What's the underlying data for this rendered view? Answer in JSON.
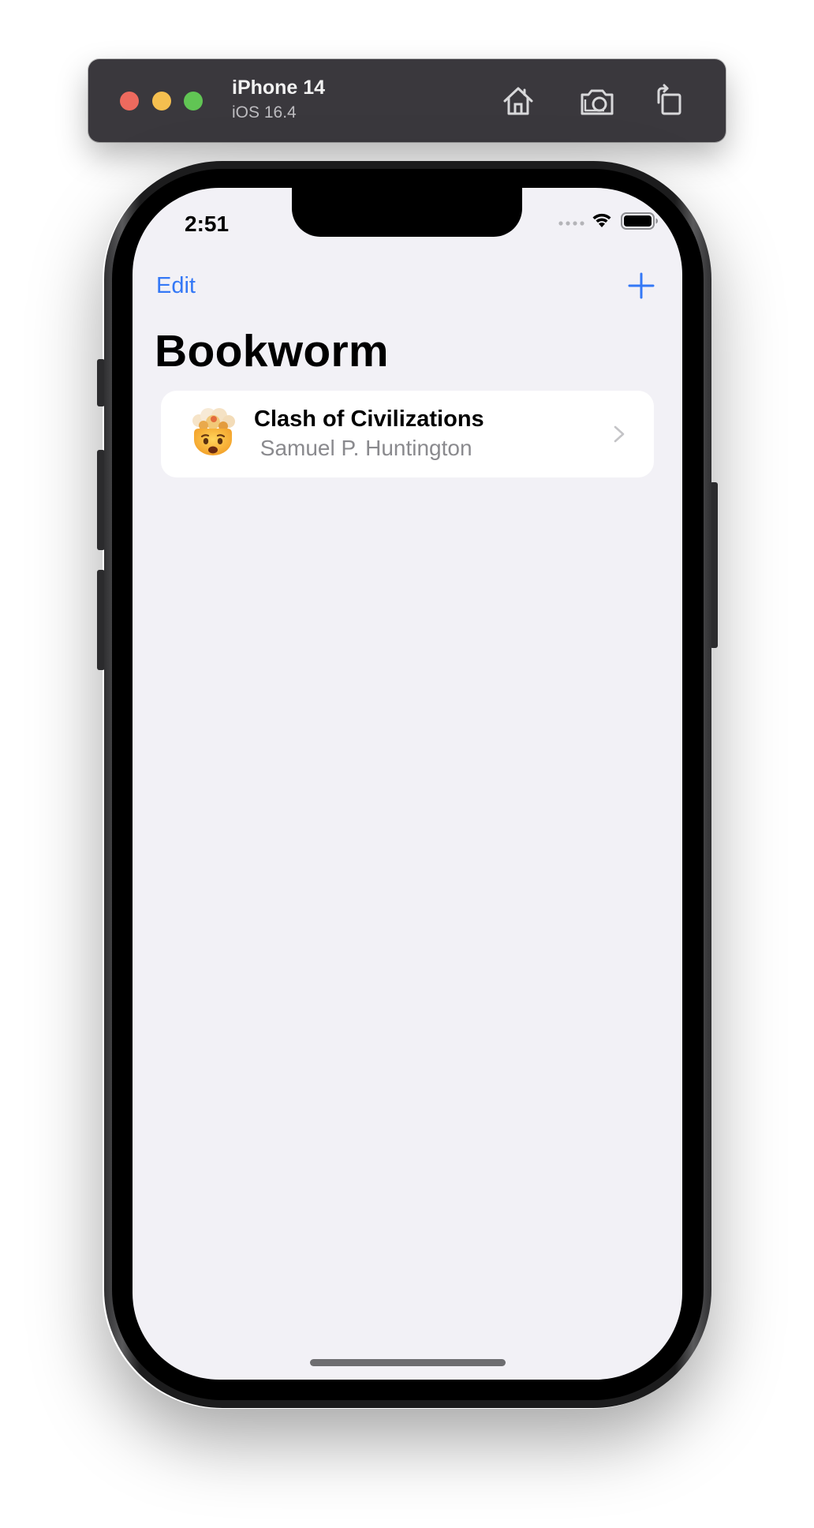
{
  "simulator": {
    "device_name": "iPhone 14",
    "os_version": "iOS 16.4",
    "icons": [
      "home-icon",
      "screenshot-icon",
      "rotate-icon"
    ]
  },
  "status_bar": {
    "time": "2:51",
    "icons": [
      "cellular-dots-icon",
      "wifi-icon",
      "battery-icon"
    ]
  },
  "nav_bar": {
    "edit_label": "Edit",
    "add_icon": "plus-icon"
  },
  "title": "Bookworm",
  "books": [
    {
      "emoji": "exploding-head-emoji",
      "title": "Clash of Civilizations",
      "author": " Samuel P. Huntington"
    }
  ],
  "colors": {
    "accent": "#3478f6",
    "background": "#f2f1f6",
    "card": "#ffffff",
    "secondary_text": "#8a8a8e"
  }
}
